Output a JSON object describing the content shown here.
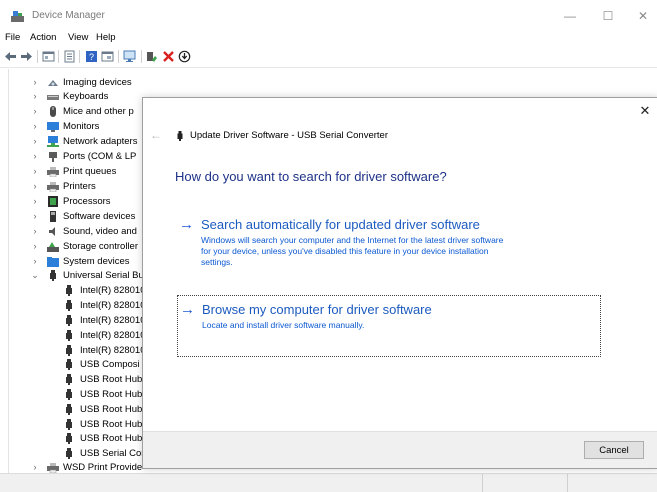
{
  "window": {
    "title": "Device Manager",
    "minimize": "—",
    "maximize": "☐",
    "close": "✕"
  },
  "menu": [
    "File",
    "Action",
    "View",
    "Help"
  ],
  "tree": {
    "categories": [
      {
        "label": "Imaging devices",
        "expanded": false
      },
      {
        "label": "Keyboards",
        "expanded": false
      },
      {
        "label": "Mice and other p",
        "expanded": false
      },
      {
        "label": "Monitors",
        "expanded": false
      },
      {
        "label": "Network adapters",
        "expanded": false
      },
      {
        "label": "Ports (COM & LP",
        "expanded": false
      },
      {
        "label": "Print queues",
        "expanded": false
      },
      {
        "label": "Printers",
        "expanded": false
      },
      {
        "label": "Processors",
        "expanded": false
      },
      {
        "label": "Software devices",
        "expanded": false
      },
      {
        "label": "Sound, video and",
        "expanded": false
      },
      {
        "label": "Storage controller",
        "expanded": false
      },
      {
        "label": "System devices",
        "expanded": false
      },
      {
        "label": "Universal Serial Bu",
        "expanded": true
      }
    ],
    "usb_children": [
      "Intel(R) 828010",
      "Intel(R) 828010",
      "Intel(R) 828010",
      "Intel(R) 828010",
      "Intel(R) 828010",
      "USB Composi",
      "USB Root Hub",
      "USB Root Hub",
      "USB Root Hub",
      "USB Root Hub",
      "USB Root Hub",
      "USB Serial Cor"
    ],
    "last_category": {
      "label": "WSD Print Provide",
      "expanded": false
    }
  },
  "dialog": {
    "title": "Update Driver Software - USB Serial Converter",
    "heading": "How do you want to search for driver software?",
    "option_auto": {
      "title": "Search automatically for updated driver software",
      "desc_lines": [
        "Windows will search your computer and the Internet for the latest driver software",
        "for your device, unless you've disabled this feature in your device installation",
        "settings."
      ]
    },
    "option_browse": {
      "title": "Browse my computer for driver software",
      "desc": "Locate and install driver software manually."
    },
    "arrow": "→",
    "back": "←",
    "close": "✕",
    "cancel_label": "Cancel"
  },
  "colors": {
    "heading": "#1e3287",
    "link": "#1c5bbf",
    "arrow": "#1c56d8"
  }
}
